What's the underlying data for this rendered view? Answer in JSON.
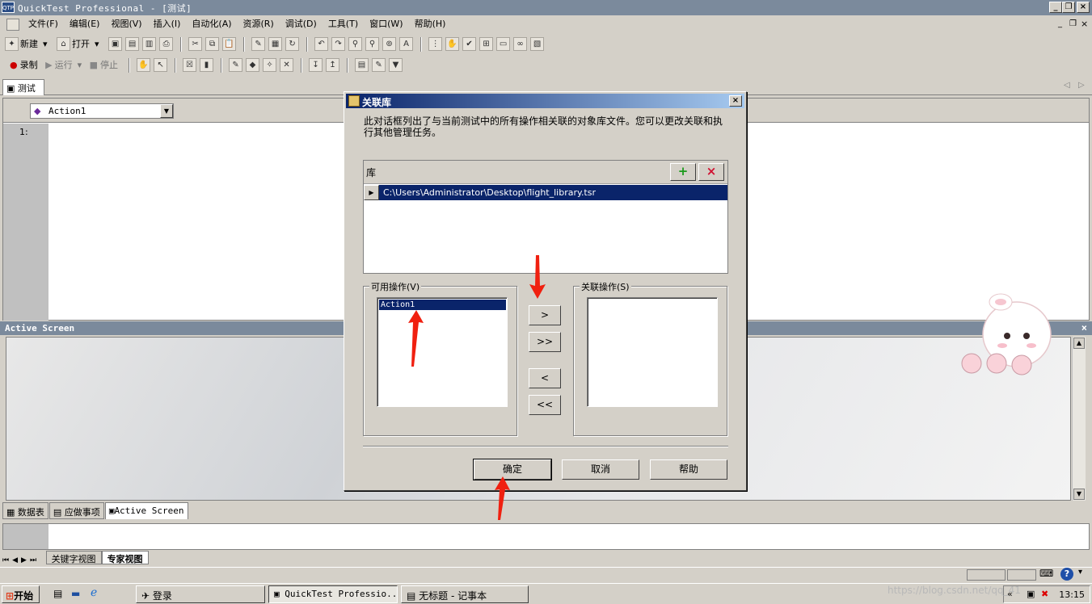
{
  "window": {
    "app_icon": "QTP",
    "title": "QuickTest Professional - [测试]"
  },
  "menu": {
    "items": [
      "文件(F)",
      "编辑(E)",
      "视图(V)",
      "插入(I)",
      "自动化(A)",
      "资源(R)",
      "调试(D)",
      "工具(T)",
      "窗口(W)",
      "帮助(H)"
    ]
  },
  "toolbar1": {
    "new_label": "新建",
    "open_label": "打开"
  },
  "toolbar2": {
    "record_label": "录制",
    "run_label": "运行",
    "stop_label": "停止"
  },
  "doc_tab": {
    "label": "测试"
  },
  "editor": {
    "action_selected": "Action1",
    "line_number": "1:"
  },
  "active_screen": {
    "title": "Active Screen"
  },
  "bottom_tabs": [
    {
      "label": "数据表"
    },
    {
      "label": "应做事项"
    },
    {
      "label": "Active Screen"
    }
  ],
  "view_tabs": [
    {
      "label": "关键字视图"
    },
    {
      "label": "专家视图"
    }
  ],
  "dialog": {
    "title": "关联库",
    "description": "此对话框列出了与当前测试中的所有操作相关联的对象库文件。您可以更改关联和执行其他管理任务。",
    "library_header": "库",
    "add_symbol": "+",
    "remove_symbol": "×",
    "library_path": "C:\\Users\\Administrator\\Desktop\\flight_library.tsr",
    "available_label": "可用操作(V)",
    "available_items": [
      "Action1"
    ],
    "associated_label": "关联操作(S)",
    "move_right": ">",
    "move_all_right": ">>",
    "move_left": "<",
    "move_all_left": "<<",
    "ok_label": "确定",
    "cancel_label": "取消",
    "help_label": "帮助"
  },
  "taskbar": {
    "start_label": "开始",
    "tasks": [
      {
        "label": "登录"
      },
      {
        "label": "QuickTest Professio..."
      },
      {
        "label": "无标题 - 记事本"
      }
    ],
    "clock": "13:15"
  },
  "watermark": "https://blog.csdn.net/qq_41"
}
